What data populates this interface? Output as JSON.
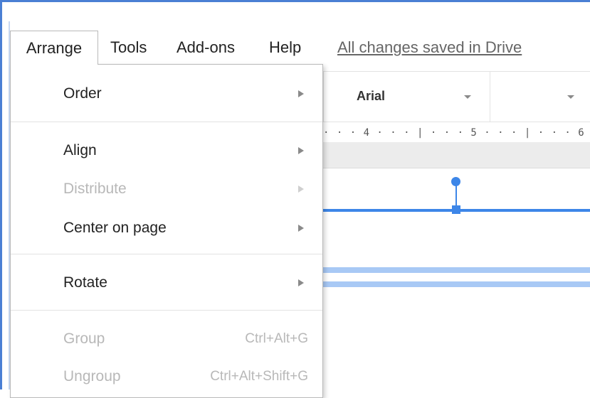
{
  "menubar": {
    "items": [
      {
        "label": "Arrange"
      },
      {
        "label": "Tools"
      },
      {
        "label": "Add-ons"
      },
      {
        "label": "Help"
      }
    ],
    "save_status": "All changes saved in Drive"
  },
  "toolbar": {
    "font_family": "Arial"
  },
  "ruler": {
    "text": "· · · 4 · · · | · · · 5 · · · | · · · 6 · · ·"
  },
  "arrange_menu": {
    "items": [
      {
        "label": "Order",
        "enabled": true,
        "submenu": true
      },
      {
        "label": "Align",
        "enabled": true,
        "submenu": true
      },
      {
        "label": "Distribute",
        "enabled": false,
        "submenu": true
      },
      {
        "label": "Center on page",
        "enabled": true,
        "submenu": true
      },
      {
        "label": "Rotate",
        "enabled": true,
        "submenu": true
      },
      {
        "label": "Group",
        "enabled": false,
        "shortcut": "Ctrl+Alt+G"
      },
      {
        "label": "Ungroup",
        "enabled": false,
        "shortcut": "Ctrl+Alt+Shift+G"
      }
    ]
  },
  "colors": {
    "accent": "#3d86e8",
    "selection_fill": "#a8c9f5",
    "disabled_text": "#b8b8b8"
  }
}
